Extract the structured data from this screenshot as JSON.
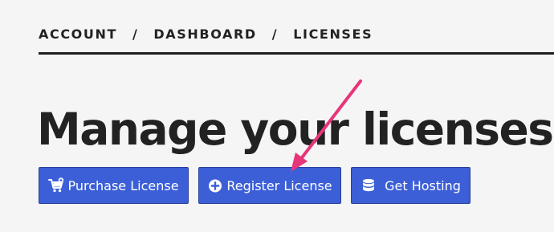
{
  "breadcrumb": {
    "items": [
      "ACCOUNT",
      "DASHBOARD",
      "LICENSES"
    ],
    "separator": "/"
  },
  "title": "Manage your licenses.",
  "actions": {
    "purchase": {
      "label": "Purchase License",
      "icon": "cart-plus-icon"
    },
    "register": {
      "label": "Register License",
      "icon": "plus-circle-icon"
    },
    "hosting": {
      "label": "Get Hosting",
      "icon": "database-icon"
    }
  },
  "colors": {
    "button_bg": "#3c5fd8",
    "button_border": "#2a3f9a",
    "annotation_arrow": "#e8357a",
    "text": "#222222",
    "background": "#f5f5f5"
  }
}
